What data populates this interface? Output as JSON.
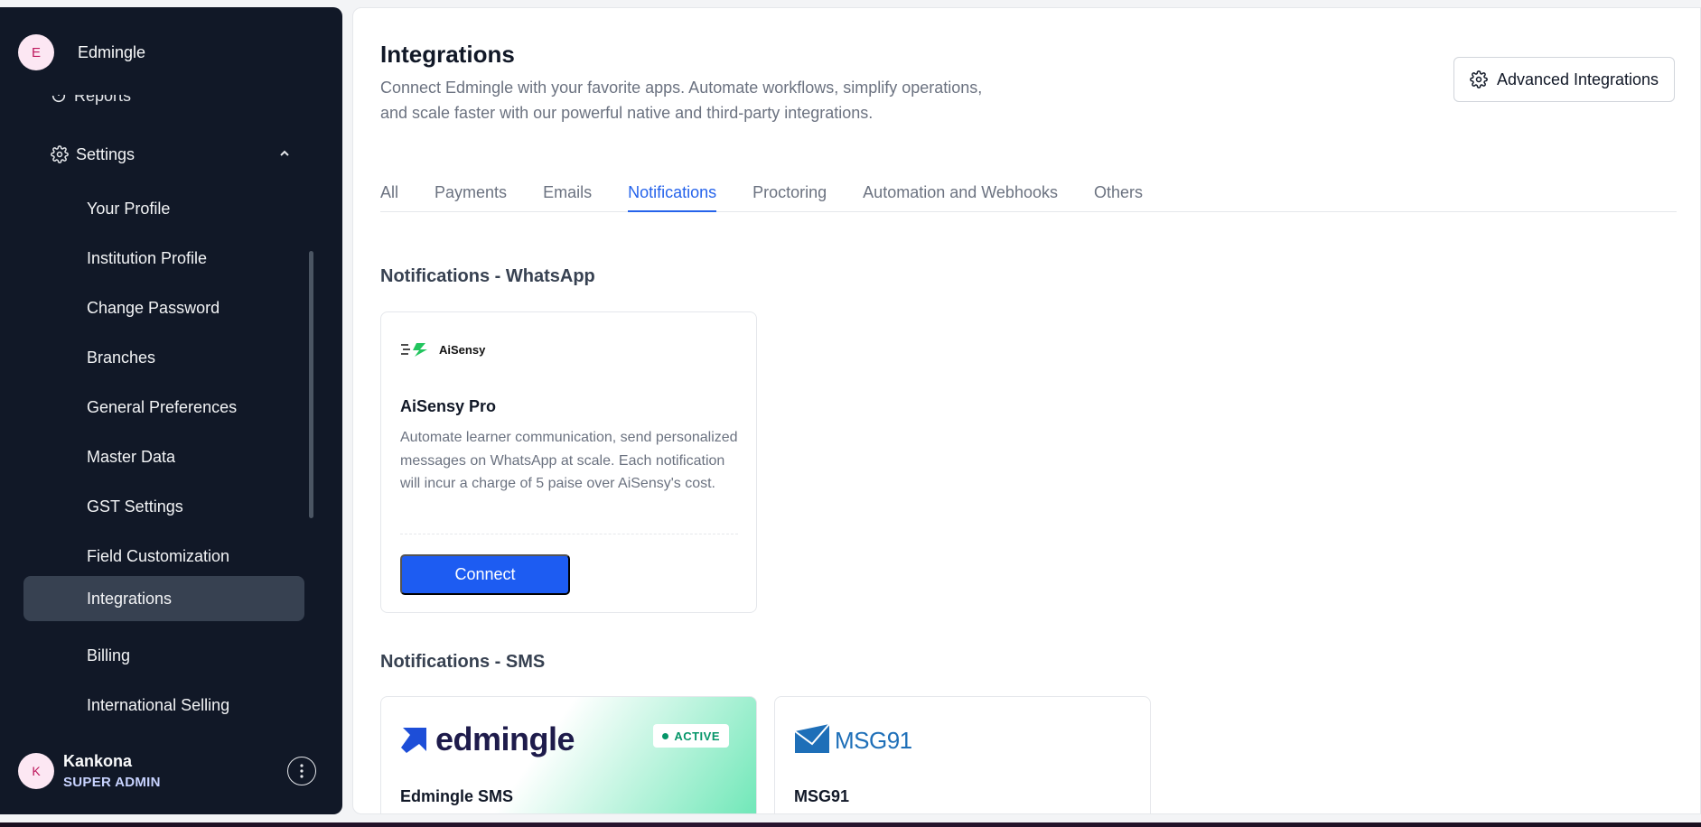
{
  "sidebar": {
    "brand": {
      "initial": "E",
      "name": "Edmingle"
    },
    "partial_item": {
      "label": "Reports",
      "icon": "reports-icon"
    },
    "settings": {
      "label": "Settings",
      "icon": "gear-icon",
      "expanded": true
    },
    "sub_items": [
      {
        "label": "Your Profile"
      },
      {
        "label": "Institution Profile"
      },
      {
        "label": "Change Password"
      },
      {
        "label": "Branches"
      },
      {
        "label": "General Preferences"
      },
      {
        "label": "Master Data"
      },
      {
        "label": "GST Settings"
      },
      {
        "label": "Field Customization"
      },
      {
        "label": "Integrations",
        "active": true
      },
      {
        "label": "Billing"
      },
      {
        "label": "International Selling"
      }
    ],
    "user": {
      "initial": "K",
      "name": "Kankona",
      "role": "SUPER ADMIN"
    }
  },
  "header": {
    "title": "Integrations",
    "description": "Connect Edmingle with your favorite apps. Automate workflows, simplify operations, and scale faster with our powerful native and third-party integrations.",
    "advanced_button": "Advanced Integrations"
  },
  "tabs": [
    {
      "label": "All"
    },
    {
      "label": "Payments"
    },
    {
      "label": "Emails"
    },
    {
      "label": "Notifications",
      "active": true
    },
    {
      "label": "Proctoring"
    },
    {
      "label": "Automation and Webhooks"
    },
    {
      "label": "Others"
    }
  ],
  "sections": {
    "whatsapp": {
      "title": "Notifications - WhatsApp",
      "cards": [
        {
          "logo_text": "AiSensy",
          "name": "AiSensy Pro",
          "description": "Automate learner communication, send personalized messages on WhatsApp at scale. Each notification will incur a charge of 5 paise over AiSensy's cost.",
          "button": "Connect"
        }
      ]
    },
    "sms": {
      "title": "Notifications - SMS",
      "cards": [
        {
          "logo_text": "edmingle",
          "name": "Edmingle SMS",
          "badge": "ACTIVE"
        },
        {
          "logo_text": "MSG91",
          "name": "MSG91"
        }
      ]
    }
  },
  "colors": {
    "sidebar_bg": "#111827",
    "accent": "#2563eb",
    "connect_button": "#1d5cf2",
    "active_green": "#059669"
  }
}
